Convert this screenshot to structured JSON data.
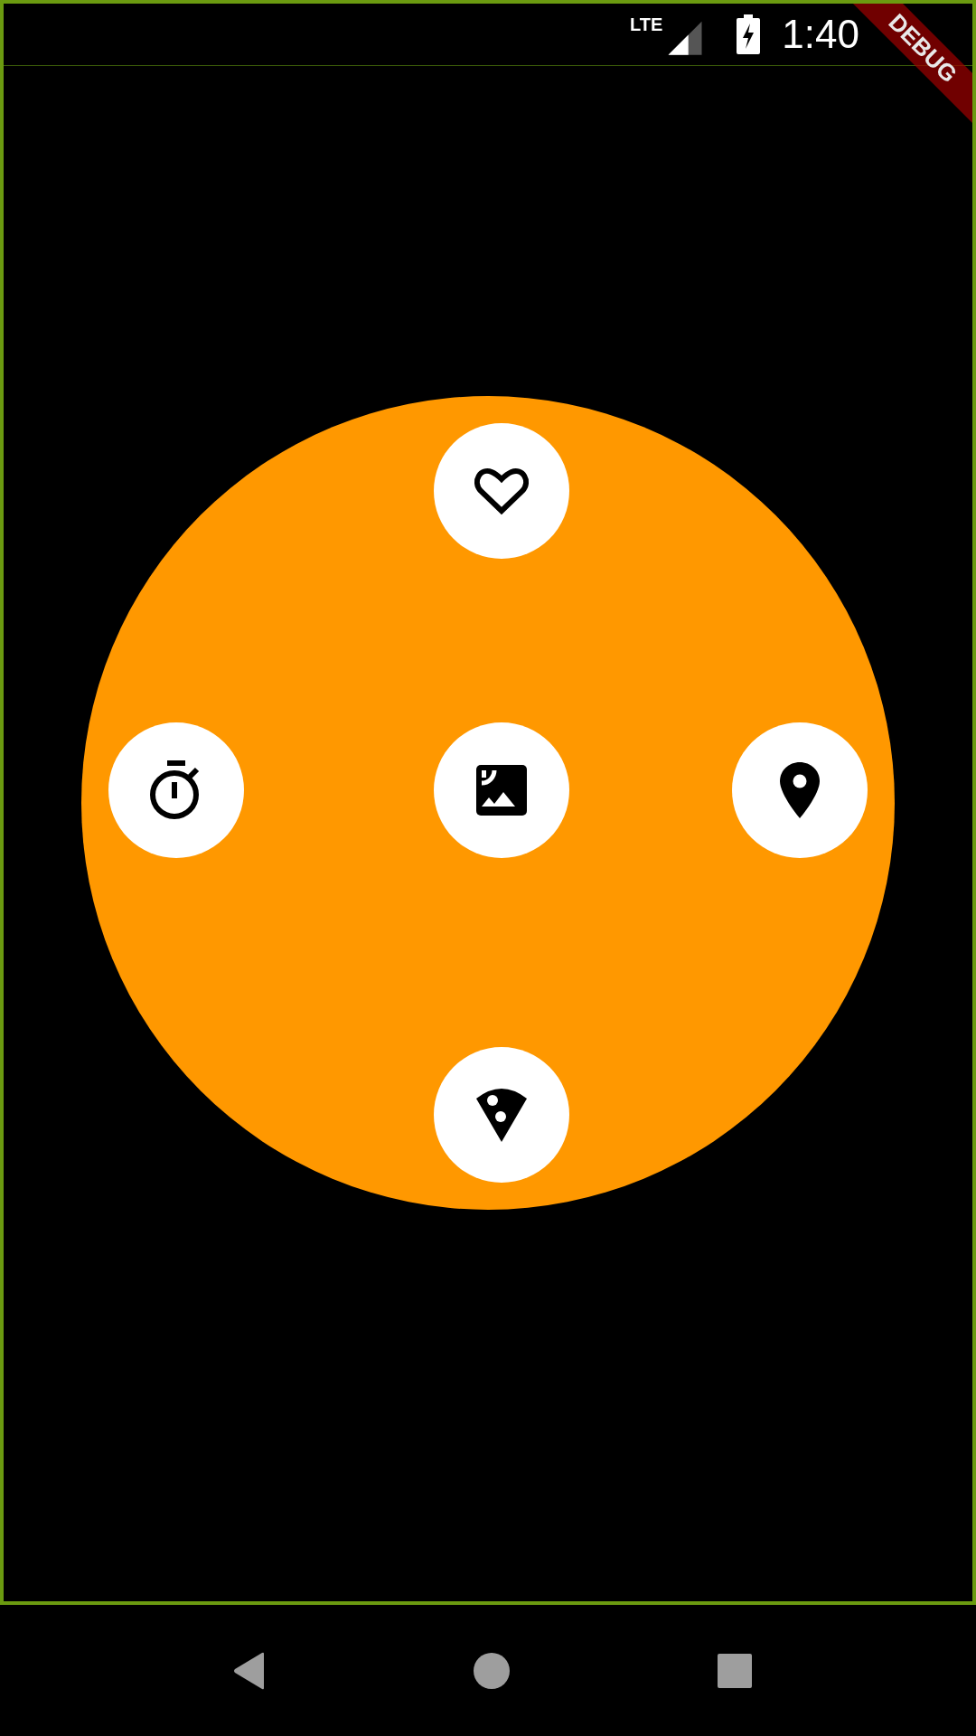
{
  "status_bar": {
    "network": "LTE",
    "time": "1:40"
  },
  "debug_banner": "DEBUG",
  "menu_buttons": [
    {
      "kind": "heart"
    },
    {
      "kind": "timer"
    },
    {
      "kind": "image"
    },
    {
      "kind": "place"
    },
    {
      "kind": "pizza"
    }
  ]
}
